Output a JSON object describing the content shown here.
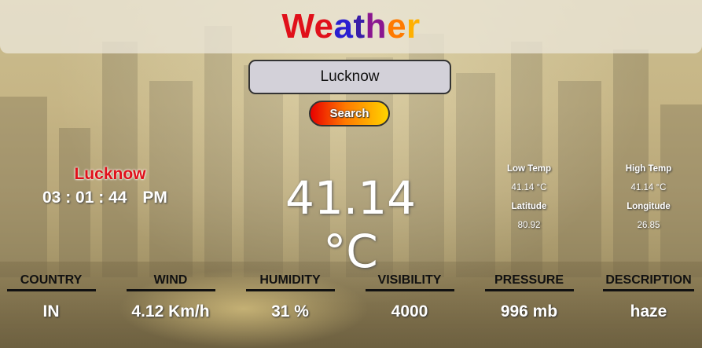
{
  "app": {
    "title_letters": [
      {
        "ch": "W",
        "color": "#e0101a"
      },
      {
        "ch": "e",
        "color": "#e0101a"
      },
      {
        "ch": "a",
        "color": "#2a1fd0"
      },
      {
        "ch": "t",
        "color": "#3a1ea8"
      },
      {
        "ch": "h",
        "color": "#8a1690"
      },
      {
        "ch": "e",
        "color": "#ff7a00"
      },
      {
        "ch": "r",
        "color": "#ffb000"
      }
    ]
  },
  "search": {
    "value": "Lucknow",
    "button_label": "Search"
  },
  "location": {
    "city": "Lucknow",
    "time": "03 : 01 : 44",
    "ampm": "PM"
  },
  "current": {
    "temperature": "41.14 °C"
  },
  "details": {
    "low_temp_label": "Low Temp",
    "low_temp_value": "41.14 °C",
    "latitude_label": "Latitude",
    "latitude_value": "80.92",
    "high_temp_label": "High Temp",
    "high_temp_value": "41.14 °C",
    "longitude_label": "Longitude",
    "longitude_value": "26.85"
  },
  "stats": [
    {
      "label": "COUNTRY",
      "value": "IN"
    },
    {
      "label": "WIND",
      "value": "4.12 Km/h"
    },
    {
      "label": "HUMIDITY",
      "value": "31 %"
    },
    {
      "label": "VISIBILITY",
      "value": "4000"
    },
    {
      "label": "PRESSURE",
      "value": "996 mb"
    },
    {
      "label": "DESCRIPTION",
      "value": "haze"
    }
  ]
}
